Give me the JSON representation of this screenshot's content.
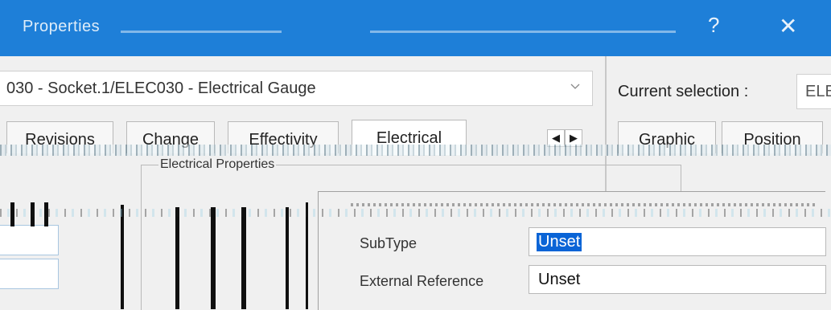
{
  "titlebar": {
    "title": "Properties",
    "help_glyph": "?",
    "close_glyph": "✕"
  },
  "object_combo": {
    "value": "030 - Socket.1/ELEC030 - Electrical Gauge"
  },
  "tabs": [
    {
      "label": "Revisions"
    },
    {
      "label": "Change"
    },
    {
      "label": "Effectivity"
    },
    {
      "label": "Electrical"
    }
  ],
  "tab_scroll": {
    "left": "◀",
    "right": "▶"
  },
  "groupbox": {
    "label": "Electrical Properties"
  },
  "properties": [
    {
      "label": "SubType",
      "value": "Unset",
      "selected": true
    },
    {
      "label": "External Reference",
      "value": "Unset",
      "selected": false
    }
  ],
  "right_pane": {
    "current_selection_label": "Current selection :",
    "current_selection_value": "ELEC",
    "tabs": [
      {
        "label": "Graphic"
      },
      {
        "label": "Position"
      }
    ]
  },
  "colors": {
    "titlebar": "#1e7fd8",
    "selection": "#0a64d6"
  }
}
